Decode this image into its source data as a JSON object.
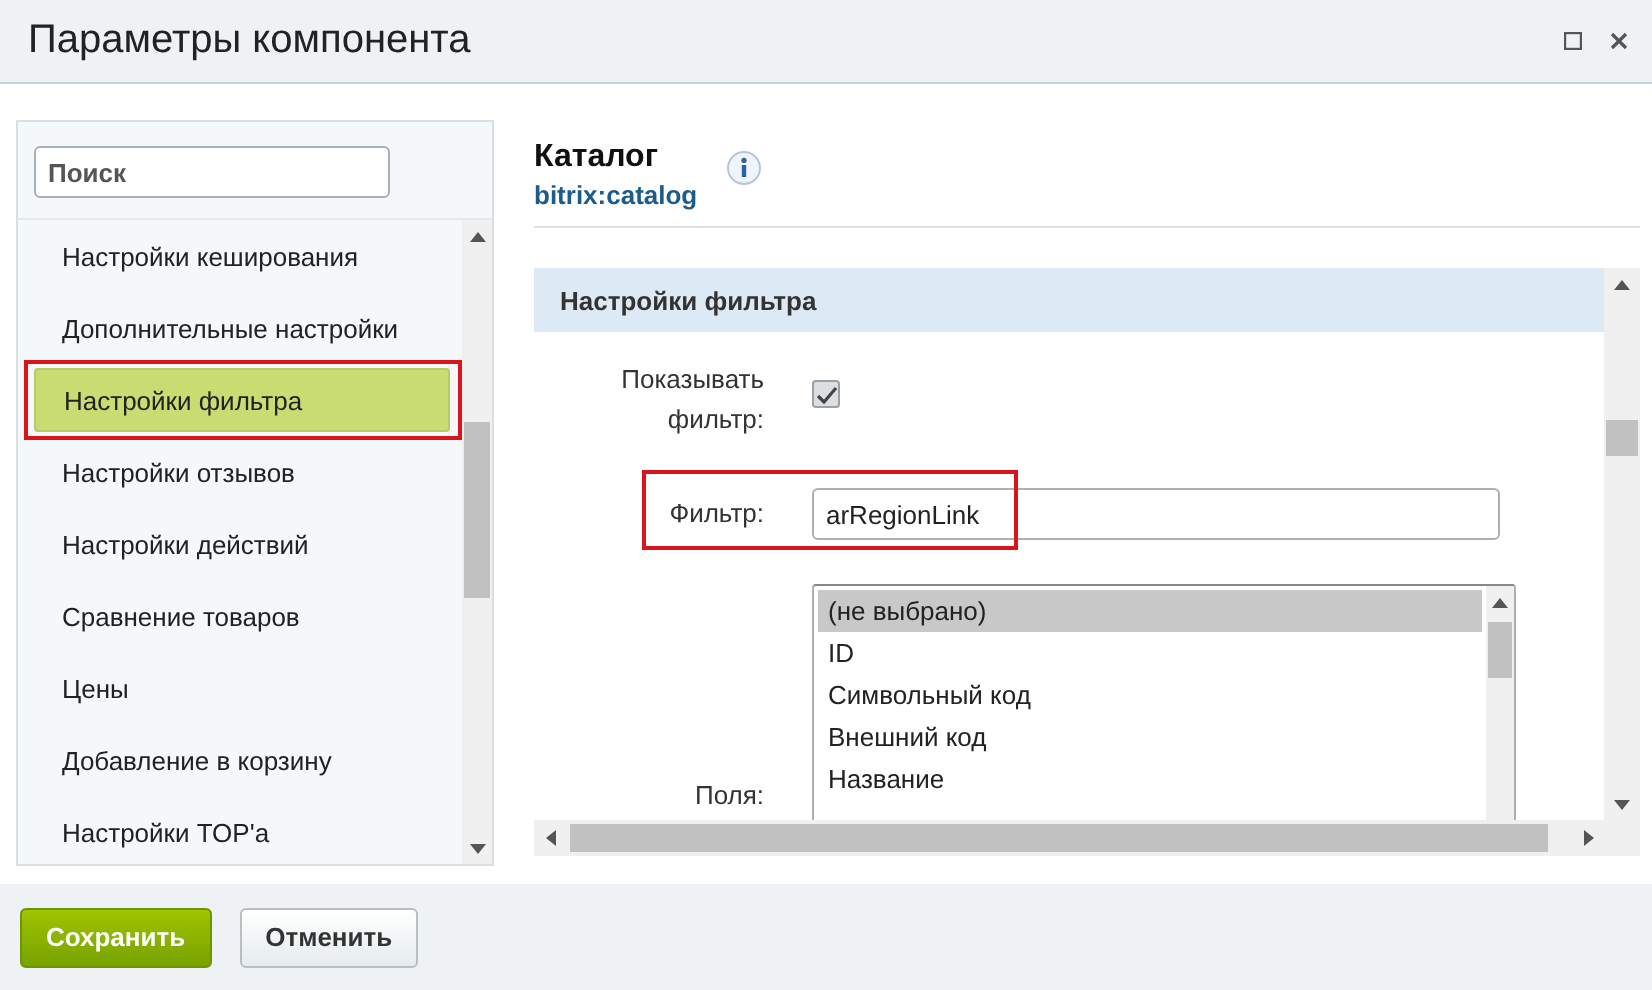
{
  "window": {
    "title": "Параметры компонента"
  },
  "search": {
    "placeholder": "Поиск"
  },
  "sidebar": {
    "items": [
      {
        "label": "Настройки кеширования",
        "selected": false,
        "highlighted": false
      },
      {
        "label": "Дополнительные настройки",
        "selected": false,
        "highlighted": false
      },
      {
        "label": "Настройки фильтра",
        "selected": true,
        "highlighted": true
      },
      {
        "label": "Настройки отзывов",
        "selected": false,
        "highlighted": false
      },
      {
        "label": "Настройки действий",
        "selected": false,
        "highlighted": false
      },
      {
        "label": "Сравнение товаров",
        "selected": false,
        "highlighted": false
      },
      {
        "label": "Цены",
        "selected": false,
        "highlighted": false
      },
      {
        "label": "Добавление в корзину",
        "selected": false,
        "highlighted": false
      },
      {
        "label": "Настройки TOP'а",
        "selected": false,
        "highlighted": false
      }
    ]
  },
  "component": {
    "title": "Каталог",
    "code": "bitrix:catalog"
  },
  "section": {
    "title": "Настройки фильтра",
    "fields": [
      {
        "kind": "checkbox",
        "label": "Показывать фильтр:",
        "checked": true
      },
      {
        "kind": "text",
        "label": "Фильтр:",
        "value": "arRegionLink",
        "highlighted": true
      },
      {
        "kind": "list",
        "label": "Поля:",
        "options": [
          {
            "label": "(не выбрано)",
            "selected": true
          },
          {
            "label": "ID",
            "selected": false
          },
          {
            "label": "Символьный код",
            "selected": false
          },
          {
            "label": "Внешний код",
            "selected": false
          },
          {
            "label": "Название",
            "selected": false
          }
        ]
      }
    ]
  },
  "buttons": [
    {
      "label": "Сохранить",
      "kind": "primary"
    },
    {
      "label": "Отменить",
      "kind": "secondary"
    }
  ]
}
